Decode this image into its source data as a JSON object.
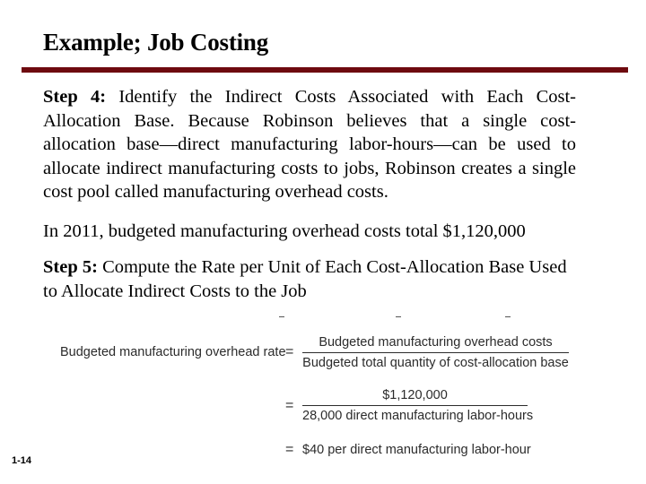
{
  "slide": {
    "title": "Example; Job Costing",
    "accent_color": "#6e0a0f",
    "slide_number": "1-14"
  },
  "step4": {
    "label": "Step 4:",
    "text": " Identify the Indirect Costs Associated with Each Cost-Allocation Base. Because Robinson believes that a single cost-allocation base—direct manufacturing labor-hours—can be used to allocate indirect manufacturing costs to jobs, Robinson creates a single cost pool called manufacturing overhead costs."
  },
  "overhead_statement": "In 2011, budgeted manufacturing overhead costs total $1,120,000",
  "step5": {
    "label": "Step 5:",
    "text": " Compute the Rate per Unit of Each Cost-Allocation Base Used to Allocate Indirect Costs to the Job"
  },
  "formula": {
    "label": "Budgeted manufacturing overhead rate",
    "equals": "=",
    "line1": {
      "numerator": "Budgeted manufacturing overhead costs",
      "denominator": "Budgeted total quantity of cost-allocation base"
    },
    "line2": {
      "numerator": "$1,120,000",
      "denominator": "28,000 direct manufacturing labor-hours"
    },
    "result": "$40 per direct manufacturing labor-hour"
  }
}
